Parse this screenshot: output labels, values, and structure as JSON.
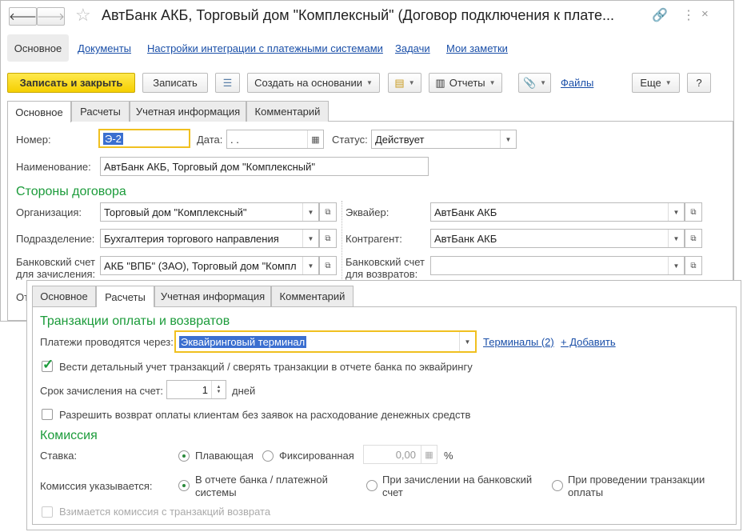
{
  "window": {
    "title": "АвтБанк АКБ, Торговый дом \"Комплексный\" (Договор подключения к плате..."
  },
  "nav_panel": {
    "items": [
      "Основное",
      "Документы",
      "Настройки интеграции с платежными системами",
      "Задачи",
      "Мои заметки"
    ]
  },
  "toolbar": {
    "save_close": "Записать и закрыть",
    "save": "Записать",
    "create_based": "Создать на основании",
    "reports": "Отчеты",
    "files": "Файлы",
    "more": "Еще",
    "help": "?"
  },
  "tabs": [
    "Основное",
    "Расчеты",
    "Учетная информация",
    "Комментарий"
  ],
  "main": {
    "number_label": "Номер:",
    "number": "Э-2",
    "date_label": "Дата:",
    "date": " .  .",
    "status_label": "Статус:",
    "status": "Действует",
    "name_label": "Наименование:",
    "name": "АвтБанк АКБ, Торговый дом \"Комплексный\"",
    "parties_header": "Стороны договора",
    "org_label": "Организация:",
    "org": "Торговый дом \"Комплексный\"",
    "dept_label": "Подразделение:",
    "dept": "Бухгалтерия торгового направления",
    "account_label": "Банковский счет для зачисления:",
    "account": "АКБ \"ВПБ\" (ЗАО), Торговый дом \"Компл",
    "acquirer_label": "Эквайер:",
    "acquirer": "АвтБанк АКБ",
    "counterparty_label": "Контрагент:",
    "counterparty": "АвтБанк АКБ",
    "refund_account_label": "Банковский счет для возвратов:",
    "refund_account": "",
    "cut_label": "От"
  },
  "settlements": {
    "header": "Транзакции оплаты и возвратов",
    "payments_label": "Платежи проводятся через:",
    "payments_value": "Эквайринговый терминал",
    "terminals_link": "Терминалы (2)",
    "add_link": "+ Добавить",
    "detailed_label": "Вести детальный учет транзакций / сверять транзакции в отчете банка по эквайрингу",
    "detailed_checked": true,
    "term_label": "Срок зачисления на счет:",
    "term_value": "1",
    "term_unit": "дней",
    "allow_refund_label": "Разрешить возврат оплаты клиентам без заявок на расходование денежных средств",
    "allow_refund_checked": false,
    "commission_header": "Комиссия",
    "rate_label": "Ставка:",
    "rate_floating": "Плавающая",
    "rate_fixed": "Фиксированная",
    "rate_value": "0,00",
    "percent": "%",
    "specified_label": "Комиссия указывается:",
    "spec_opt1": "В отчете банка / платежной системы",
    "spec_opt2": "При зачислении на банковский счет",
    "spec_opt3": "При проведении транзакции оплаты",
    "refund_commission_label": "Взимается комиссия с транзакций возврата"
  }
}
